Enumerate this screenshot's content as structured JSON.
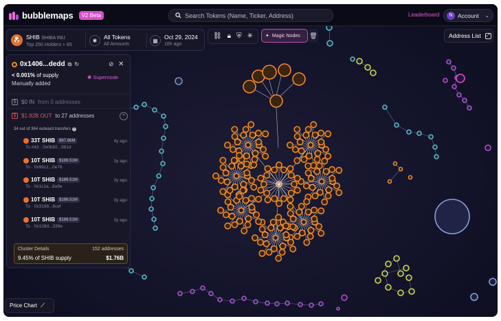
{
  "app": {
    "brand": "bubblemaps",
    "badge": "V2 Beta",
    "search_placeholder": "Search Tokens (Name, Ticker, Address)",
    "leaderboard": "Leaderboard",
    "account": "Account",
    "avatar_initial": "N",
    "address_list": "Address List",
    "price_chart": "Price Chart"
  },
  "token": {
    "ticker": "SHIB",
    "name": "SHIBA INU",
    "subtitle": "Top 250 Holders + 85",
    "filter_title": "All Tokens",
    "filter_sub": "All Amounts",
    "date": "Oct 29, 2024",
    "date_sub": "16h ago"
  },
  "toolbar": {
    "magic_nodes": "Magic Nodes"
  },
  "panel": {
    "address": "0x1406...dedd",
    "supply_pct": "< 0.001%",
    "supply_label": "of supply",
    "manually_added": "Manually added",
    "supernode": "Supernode",
    "in_amount": "$0 IN",
    "in_from": "from 0 addresses",
    "out_amount": "$1.92B OUT",
    "out_to": "to 27 addresses",
    "transfers_note": "34 out of 364 outward transfers",
    "transfers": [
      {
        "amount": "33T SHIB",
        "usd": "$67.86M",
        "to": "To #43 · 0x0b92...981d",
        "ago": "4y ago"
      },
      {
        "amount": "10T SHIB",
        "usd": "$186.51M",
        "to": "To · 0x99c1...0e76",
        "ago": "3y ago"
      },
      {
        "amount": "10T SHIB",
        "usd": "$186.51M",
        "to": "To · 0x1c1a...8a9e",
        "ago": "3y ago"
      },
      {
        "amount": "10T SHIB",
        "usd": "$186.51M",
        "to": "To · 0x3198...6cef",
        "ago": "3y ago"
      },
      {
        "amount": "10T SHIB",
        "usd": "$186.51M",
        "to": "To · 0x128d...339e",
        "ago": "3y ago"
      }
    ],
    "cluster": {
      "title": "Cluster Details",
      "addresses": "152 addresses",
      "supply": "9.45% of SHIB supply",
      "value": "$1.76B"
    }
  },
  "colors": {
    "accent": "#e25bd4",
    "orange": "#f08a2b",
    "teal": "#5bb7c9",
    "purple": "#b04fd1",
    "yellow": "#d9d24a",
    "background": "#13132a"
  }
}
